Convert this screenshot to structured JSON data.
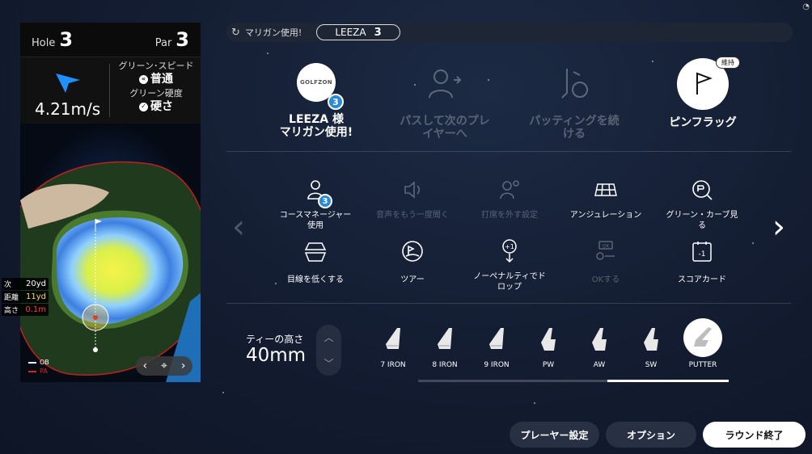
{
  "hole": {
    "hole_label": "Hole",
    "hole_number": "3",
    "par_label": "Par",
    "par_number": "3"
  },
  "wind": {
    "speed": "4.21m/s",
    "icon": "wind-direction-icon"
  },
  "green": {
    "speed_label": "グリーン･スピード",
    "speed_value": "普通",
    "hardness_label": "グリーン硬度",
    "hardness_value": "硬さ"
  },
  "distance": [
    {
      "label": "次",
      "value": "20yd",
      "color": "#ffffff"
    },
    {
      "label": "距離",
      "value": "11yd",
      "color": "#ffd84a"
    },
    {
      "label": "高さ",
      "value": "0.1m",
      "color": "#ff3b3b"
    }
  ],
  "legend": [
    {
      "label": "OB",
      "color": "#ffffff"
    },
    {
      "label": "PA",
      "color": "#e02020"
    }
  ],
  "mulligan": {
    "text": "マリガン使用!",
    "player_name": "LEEZA",
    "player_number": "3"
  },
  "big_actions": [
    {
      "label": "LEEZA 様\nマリガン使用!",
      "logo": "GOLFZON",
      "badge": "3",
      "enabled": true
    },
    {
      "label": "パスして次のプレ\nイヤーへ",
      "enabled": false
    },
    {
      "label": "パッティングを続\nける",
      "enabled": false
    },
    {
      "label": "ピンフラッグ",
      "keep_badge": "維持",
      "enabled": true
    }
  ],
  "options_row1": [
    {
      "label": "コースマネージャー\n使用",
      "badge": "3",
      "icon": "course-manager-icon",
      "enabled": true
    },
    {
      "label": "音声をもう一度聞く",
      "icon": "speaker-icon",
      "enabled": false
    },
    {
      "label": "打席を外す設定",
      "icon": "leave-box-icon",
      "enabled": false
    },
    {
      "label": "アンジュレーション",
      "icon": "undulation-grid-icon",
      "enabled": true
    },
    {
      "label": "グリーン・カーブ見\nる",
      "icon": "green-curve-icon",
      "enabled": true
    }
  ],
  "options_row2": [
    {
      "label": "目線を低くする",
      "icon": "low-view-icon",
      "enabled": true
    },
    {
      "label": "ツアー",
      "icon": "tour-icon",
      "enabled": true
    },
    {
      "label": "ノーペナルティでド\nロップ",
      "icon": "drop-no-penalty-icon",
      "enabled": true
    },
    {
      "label": "OKする",
      "icon": "ok-icon",
      "enabled": false
    },
    {
      "label": "スコアカード",
      "icon": "scorecard-icon",
      "enabled": true
    }
  ],
  "tee": {
    "label": "ティーの高さ",
    "value": "40mm"
  },
  "clubs": [
    {
      "label": "7 IRON",
      "selected": false
    },
    {
      "label": "8 IRON",
      "selected": false
    },
    {
      "label": "9 IRON",
      "selected": false
    },
    {
      "label": "PW",
      "selected": false
    },
    {
      "label": "AW",
      "selected": false
    },
    {
      "label": "SW",
      "selected": false
    },
    {
      "label": "PUTTER",
      "selected": true
    }
  ],
  "buttons": {
    "player_settings": "プレーヤー設定",
    "options": "オプション",
    "end_round": "ラウンド終了"
  }
}
